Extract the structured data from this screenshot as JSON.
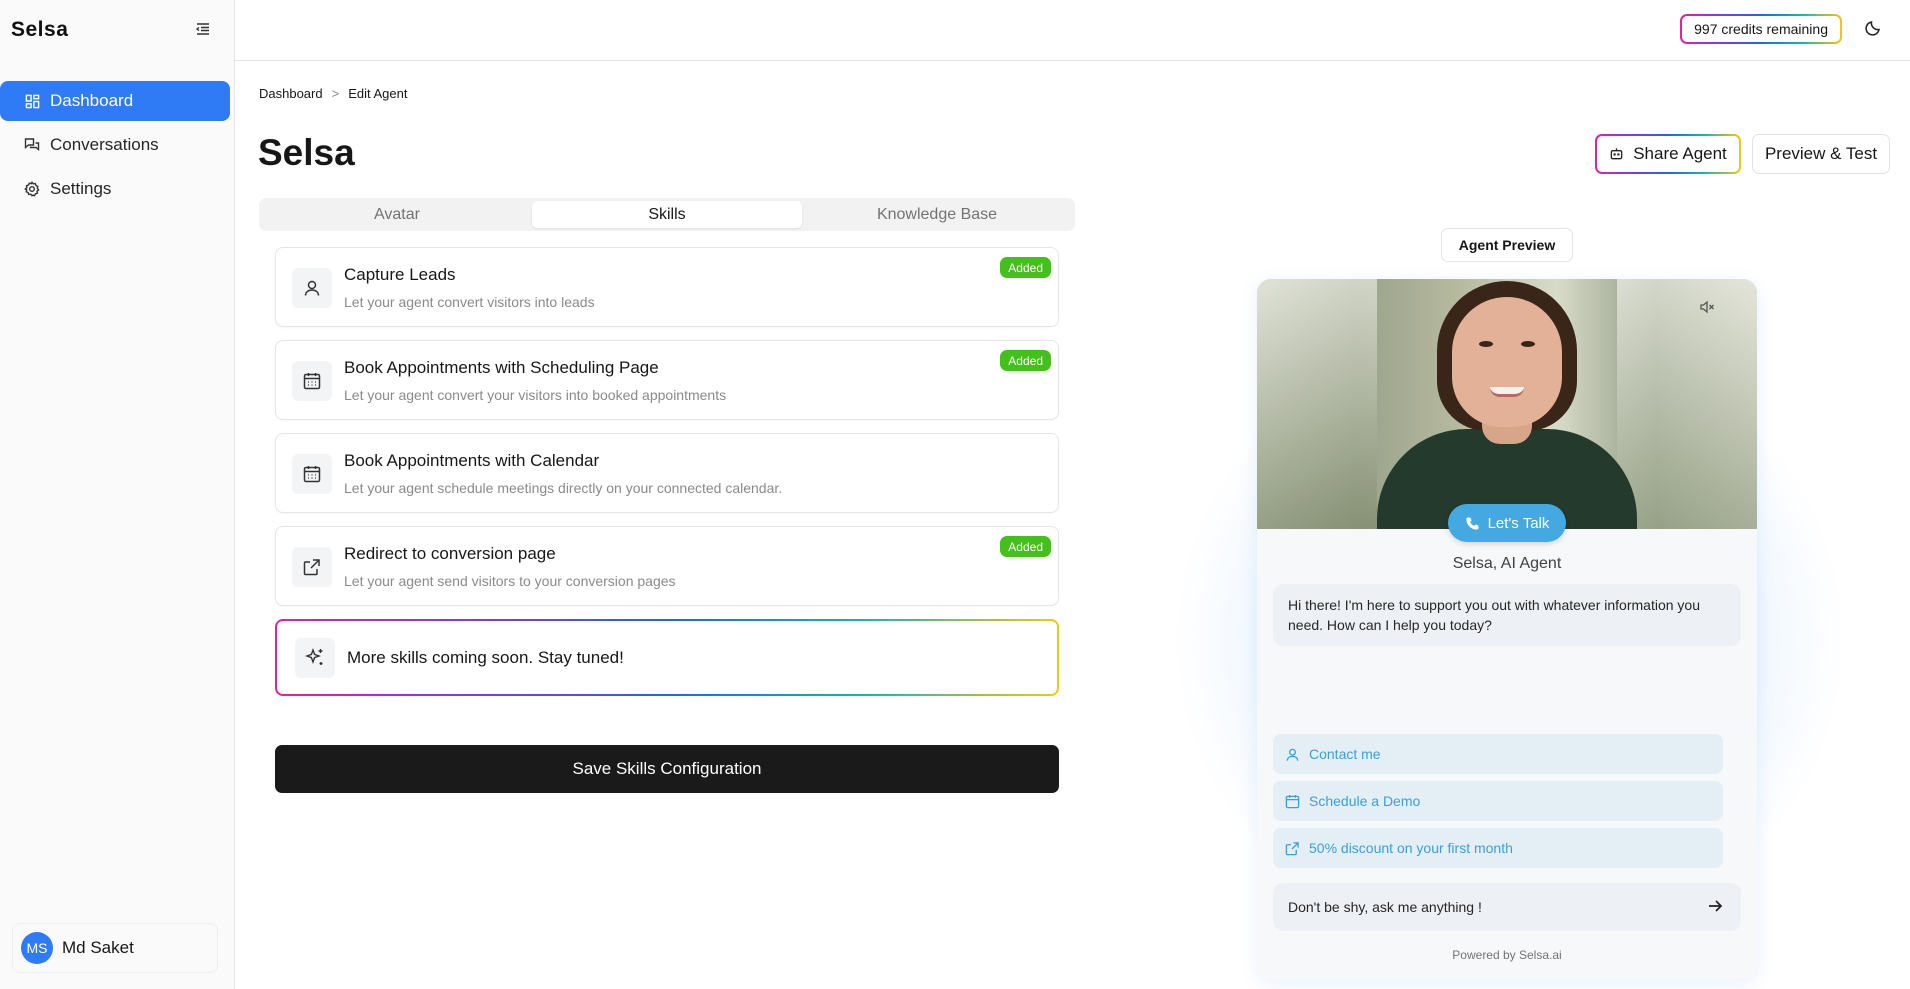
{
  "app": {
    "brand": "Selsa"
  },
  "sidebar": {
    "items": [
      {
        "label": "Dashboard",
        "icon": "dashboard-icon",
        "active": true
      },
      {
        "label": "Conversations",
        "icon": "chat-icon",
        "active": false
      },
      {
        "label": "Settings",
        "icon": "gear-icon",
        "active": false
      }
    ],
    "user": {
      "initials": "MS",
      "name": "Md Saket"
    }
  },
  "topbar": {
    "credits": "997 credits remaining"
  },
  "breadcrumb": {
    "root": "Dashboard",
    "separator": ">",
    "current": "Edit Agent"
  },
  "page": {
    "title": "Selsa",
    "share_label": "Share Agent",
    "preview_label": "Preview & Test"
  },
  "tabs": [
    {
      "label": "Avatar",
      "active": false
    },
    {
      "label": "Skills",
      "active": true
    },
    {
      "label": "Knowledge Base",
      "active": false
    }
  ],
  "skills": [
    {
      "title": "Capture Leads",
      "desc": "Let your agent convert visitors into leads",
      "badge": "Added",
      "icon": "user-icon"
    },
    {
      "title": "Book Appointments with Scheduling Page",
      "desc": "Let your agent convert your visitors into booked appointments",
      "badge": "Added",
      "icon": "calendar-icon"
    },
    {
      "title": "Book Appointments with Calendar",
      "desc": "Let your agent schedule meetings directly on your connected calendar.",
      "badge": "",
      "icon": "calendar-icon"
    },
    {
      "title": "Redirect to conversion page",
      "desc": "Let your agent send visitors to your conversion pages",
      "badge": "Added",
      "icon": "external-link-icon"
    }
  ],
  "coming_soon": "More skills coming soon. Stay tuned!",
  "save_label": "Save Skills Configuration",
  "preview": {
    "label": "Agent Preview",
    "talk_label": "Let's Talk",
    "agent_name": "Selsa, AI Agent",
    "greeting": "Hi there! I'm here to support you out with whatever information you need. How can I help you today?",
    "actions": [
      {
        "label": "Contact me",
        "icon": "user-icon"
      },
      {
        "label": "Schedule a Demo",
        "icon": "calendar-icon"
      },
      {
        "label": "50% discount on your first month",
        "icon": "external-link-icon"
      }
    ],
    "input_placeholder": "Don't be shy, ask me anything !",
    "powered_by": "Powered by Selsa.ai"
  },
  "colors": {
    "accent": "#2f7bf5",
    "badge": "#43c01c",
    "preview_accent": "#44a9e0",
    "save_button": "#1a1a1a"
  }
}
